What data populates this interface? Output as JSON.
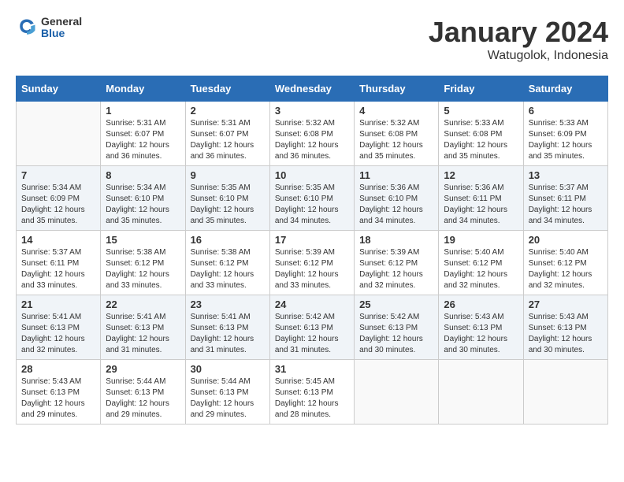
{
  "header": {
    "logo_general": "General",
    "logo_blue": "Blue",
    "month_title": "January 2024",
    "location": "Watugolok, Indonesia"
  },
  "days_of_week": [
    "Sunday",
    "Monday",
    "Tuesday",
    "Wednesday",
    "Thursday",
    "Friday",
    "Saturday"
  ],
  "weeks": [
    [
      {
        "day": "",
        "sunrise": "",
        "sunset": "",
        "daylight": ""
      },
      {
        "day": "1",
        "sunrise": "Sunrise: 5:31 AM",
        "sunset": "Sunset: 6:07 PM",
        "daylight": "Daylight: 12 hours and 36 minutes."
      },
      {
        "day": "2",
        "sunrise": "Sunrise: 5:31 AM",
        "sunset": "Sunset: 6:07 PM",
        "daylight": "Daylight: 12 hours and 36 minutes."
      },
      {
        "day": "3",
        "sunrise": "Sunrise: 5:32 AM",
        "sunset": "Sunset: 6:08 PM",
        "daylight": "Daylight: 12 hours and 36 minutes."
      },
      {
        "day": "4",
        "sunrise": "Sunrise: 5:32 AM",
        "sunset": "Sunset: 6:08 PM",
        "daylight": "Daylight: 12 hours and 35 minutes."
      },
      {
        "day": "5",
        "sunrise": "Sunrise: 5:33 AM",
        "sunset": "Sunset: 6:08 PM",
        "daylight": "Daylight: 12 hours and 35 minutes."
      },
      {
        "day": "6",
        "sunrise": "Sunrise: 5:33 AM",
        "sunset": "Sunset: 6:09 PM",
        "daylight": "Daylight: 12 hours and 35 minutes."
      }
    ],
    [
      {
        "day": "7",
        "sunrise": "Sunrise: 5:34 AM",
        "sunset": "Sunset: 6:09 PM",
        "daylight": "Daylight: 12 hours and 35 minutes."
      },
      {
        "day": "8",
        "sunrise": "Sunrise: 5:34 AM",
        "sunset": "Sunset: 6:10 PM",
        "daylight": "Daylight: 12 hours and 35 minutes."
      },
      {
        "day": "9",
        "sunrise": "Sunrise: 5:35 AM",
        "sunset": "Sunset: 6:10 PM",
        "daylight": "Daylight: 12 hours and 35 minutes."
      },
      {
        "day": "10",
        "sunrise": "Sunrise: 5:35 AM",
        "sunset": "Sunset: 6:10 PM",
        "daylight": "Daylight: 12 hours and 34 minutes."
      },
      {
        "day": "11",
        "sunrise": "Sunrise: 5:36 AM",
        "sunset": "Sunset: 6:10 PM",
        "daylight": "Daylight: 12 hours and 34 minutes."
      },
      {
        "day": "12",
        "sunrise": "Sunrise: 5:36 AM",
        "sunset": "Sunset: 6:11 PM",
        "daylight": "Daylight: 12 hours and 34 minutes."
      },
      {
        "day": "13",
        "sunrise": "Sunrise: 5:37 AM",
        "sunset": "Sunset: 6:11 PM",
        "daylight": "Daylight: 12 hours and 34 minutes."
      }
    ],
    [
      {
        "day": "14",
        "sunrise": "Sunrise: 5:37 AM",
        "sunset": "Sunset: 6:11 PM",
        "daylight": "Daylight: 12 hours and 33 minutes."
      },
      {
        "day": "15",
        "sunrise": "Sunrise: 5:38 AM",
        "sunset": "Sunset: 6:12 PM",
        "daylight": "Daylight: 12 hours and 33 minutes."
      },
      {
        "day": "16",
        "sunrise": "Sunrise: 5:38 AM",
        "sunset": "Sunset: 6:12 PM",
        "daylight": "Daylight: 12 hours and 33 minutes."
      },
      {
        "day": "17",
        "sunrise": "Sunrise: 5:39 AM",
        "sunset": "Sunset: 6:12 PM",
        "daylight": "Daylight: 12 hours and 33 minutes."
      },
      {
        "day": "18",
        "sunrise": "Sunrise: 5:39 AM",
        "sunset": "Sunset: 6:12 PM",
        "daylight": "Daylight: 12 hours and 32 minutes."
      },
      {
        "day": "19",
        "sunrise": "Sunrise: 5:40 AM",
        "sunset": "Sunset: 6:12 PM",
        "daylight": "Daylight: 12 hours and 32 minutes."
      },
      {
        "day": "20",
        "sunrise": "Sunrise: 5:40 AM",
        "sunset": "Sunset: 6:12 PM",
        "daylight": "Daylight: 12 hours and 32 minutes."
      }
    ],
    [
      {
        "day": "21",
        "sunrise": "Sunrise: 5:41 AM",
        "sunset": "Sunset: 6:13 PM",
        "daylight": "Daylight: 12 hours and 32 minutes."
      },
      {
        "day": "22",
        "sunrise": "Sunrise: 5:41 AM",
        "sunset": "Sunset: 6:13 PM",
        "daylight": "Daylight: 12 hours and 31 minutes."
      },
      {
        "day": "23",
        "sunrise": "Sunrise: 5:41 AM",
        "sunset": "Sunset: 6:13 PM",
        "daylight": "Daylight: 12 hours and 31 minutes."
      },
      {
        "day": "24",
        "sunrise": "Sunrise: 5:42 AM",
        "sunset": "Sunset: 6:13 PM",
        "daylight": "Daylight: 12 hours and 31 minutes."
      },
      {
        "day": "25",
        "sunrise": "Sunrise: 5:42 AM",
        "sunset": "Sunset: 6:13 PM",
        "daylight": "Daylight: 12 hours and 30 minutes."
      },
      {
        "day": "26",
        "sunrise": "Sunrise: 5:43 AM",
        "sunset": "Sunset: 6:13 PM",
        "daylight": "Daylight: 12 hours and 30 minutes."
      },
      {
        "day": "27",
        "sunrise": "Sunrise: 5:43 AM",
        "sunset": "Sunset: 6:13 PM",
        "daylight": "Daylight: 12 hours and 30 minutes."
      }
    ],
    [
      {
        "day": "28",
        "sunrise": "Sunrise: 5:43 AM",
        "sunset": "Sunset: 6:13 PM",
        "daylight": "Daylight: 12 hours and 29 minutes."
      },
      {
        "day": "29",
        "sunrise": "Sunrise: 5:44 AM",
        "sunset": "Sunset: 6:13 PM",
        "daylight": "Daylight: 12 hours and 29 minutes."
      },
      {
        "day": "30",
        "sunrise": "Sunrise: 5:44 AM",
        "sunset": "Sunset: 6:13 PM",
        "daylight": "Daylight: 12 hours and 29 minutes."
      },
      {
        "day": "31",
        "sunrise": "Sunrise: 5:45 AM",
        "sunset": "Sunset: 6:13 PM",
        "daylight": "Daylight: 12 hours and 28 minutes."
      },
      {
        "day": "",
        "sunrise": "",
        "sunset": "",
        "daylight": ""
      },
      {
        "day": "",
        "sunrise": "",
        "sunset": "",
        "daylight": ""
      },
      {
        "day": "",
        "sunrise": "",
        "sunset": "",
        "daylight": ""
      }
    ]
  ]
}
